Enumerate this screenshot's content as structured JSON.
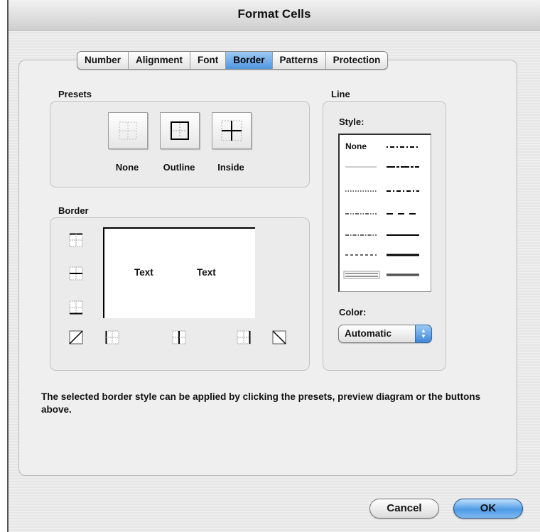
{
  "window": {
    "title": "Format Cells"
  },
  "tabs": [
    {
      "label": "Number",
      "active": false
    },
    {
      "label": "Alignment",
      "active": false
    },
    {
      "label": "Font",
      "active": false
    },
    {
      "label": "Border",
      "active": true
    },
    {
      "label": "Patterns",
      "active": false
    },
    {
      "label": "Protection",
      "active": false
    }
  ],
  "presets": {
    "title": "Presets",
    "items": [
      {
        "label": "None",
        "icon": "preset-none-icon"
      },
      {
        "label": "Outline",
        "icon": "preset-outline-icon"
      },
      {
        "label": "Inside",
        "icon": "preset-inside-icon"
      }
    ]
  },
  "border": {
    "title": "Border",
    "preview_text_left": "Text",
    "preview_text_right": "Text",
    "buttons": [
      "border-top-icon",
      "border-inside-horizontal-icon",
      "border-bottom-icon",
      "border-diagonal-up-icon",
      "border-left-icon",
      "border-inside-vertical-icon",
      "border-right-icon",
      "border-diagonal-down-icon"
    ]
  },
  "line": {
    "title": "Line",
    "style_label": "Style:",
    "style_none_label": "None",
    "color_label": "Color:",
    "color_value": "Automatic"
  },
  "hint": "The selected border style can be applied by clicking the presets, preview diagram or the buttons above.",
  "buttons": {
    "cancel": "Cancel",
    "ok": "OK"
  },
  "colors": {
    "accent": "#4f96e0",
    "window_bg": "#ececec"
  }
}
